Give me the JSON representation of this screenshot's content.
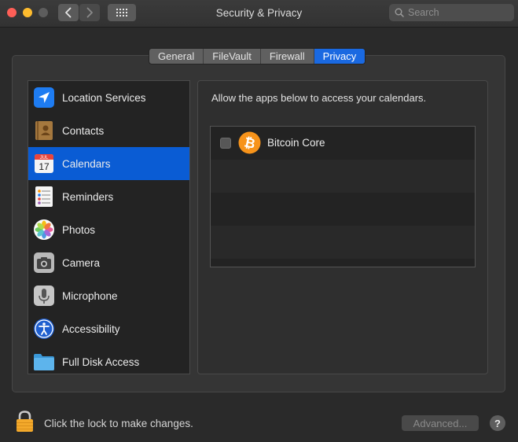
{
  "window": {
    "title": "Security & Privacy",
    "search_placeholder": "Search"
  },
  "tabs": [
    {
      "label": "General"
    },
    {
      "label": "FileVault"
    },
    {
      "label": "Firewall"
    },
    {
      "label": "Privacy",
      "selected": true
    }
  ],
  "sidebar": {
    "items": [
      {
        "label": "Location Services",
        "icon": "location-arrow-icon"
      },
      {
        "label": "Contacts",
        "icon": "contacts-book-icon"
      },
      {
        "label": "Calendars",
        "icon": "calendar-icon",
        "selected": true
      },
      {
        "label": "Reminders",
        "icon": "reminders-list-icon"
      },
      {
        "label": "Photos",
        "icon": "photos-flower-icon"
      },
      {
        "label": "Camera",
        "icon": "camera-icon"
      },
      {
        "label": "Microphone",
        "icon": "microphone-icon"
      },
      {
        "label": "Accessibility",
        "icon": "accessibility-icon"
      },
      {
        "label": "Full Disk Access",
        "icon": "folder-icon"
      }
    ]
  },
  "main": {
    "description": "Allow the apps below to access your calendars.",
    "apps": [
      {
        "name": "Bitcoin Core",
        "checked": false,
        "icon": "bitcoin-icon"
      }
    ]
  },
  "calendar_icon": {
    "month": "JUL",
    "day": "17"
  },
  "footer": {
    "lock_text": "Click the lock to make changes.",
    "advanced_label": "Advanced...",
    "help_label": "?"
  },
  "colors": {
    "accent": "#0a5cd4",
    "tab_active": "#1a69e1",
    "bitcoin": "#f7931a"
  }
}
